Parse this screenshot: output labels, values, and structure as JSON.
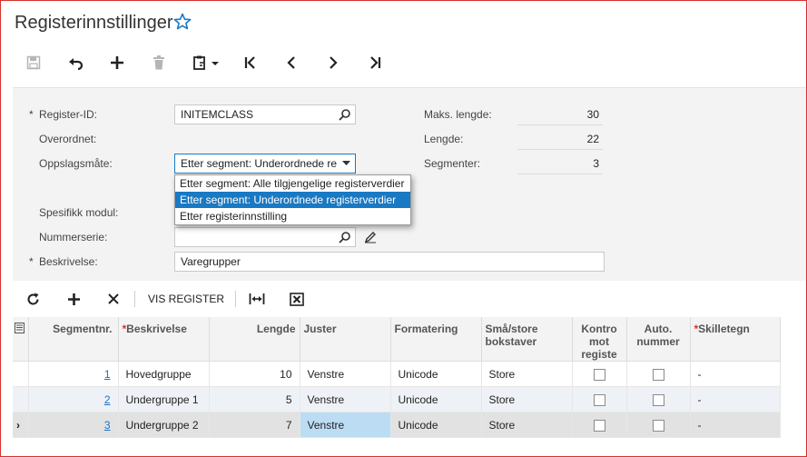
{
  "page": {
    "title": "Registerinnstillinger"
  },
  "toolbar": {
    "icons": [
      "save-icon",
      "undo-icon",
      "add-icon",
      "delete-icon",
      "paste-icon",
      "first-icon",
      "prev-icon",
      "next-icon",
      "last-icon"
    ]
  },
  "form": {
    "register_id": {
      "label": "Register-ID:",
      "value": "INITEMCLASS"
    },
    "overordnet": {
      "label": "Overordnet:"
    },
    "oppslagsmate": {
      "label": "Oppslagsmåte:",
      "value": "Etter segment: Underordnede re",
      "options": [
        "Etter segment: Alle tilgjengelige registerverdier",
        "Etter segment: Underordnede registerverdier",
        "Etter registerinnstilling"
      ],
      "selected_index": 1
    },
    "spesifikk_modul": {
      "label": "Spesifikk modul:"
    },
    "nummerserie": {
      "label": "Nummerserie:"
    },
    "beskrivelse": {
      "label": "Beskrivelse:",
      "value": "Varegrupper"
    },
    "maks_lengde": {
      "label": "Maks. lengde:",
      "value": "30"
    },
    "lengde": {
      "label": "Lengde:",
      "value": "22"
    },
    "segmenter": {
      "label": "Segmenter:",
      "value": "3"
    },
    "required_mark": "*"
  },
  "grid_toolbar": {
    "vis_register": "VIS REGISTER"
  },
  "grid": {
    "columns": [
      "Segmentnr.",
      "Beskrivelse",
      "Lengde",
      "Juster",
      "Formatering",
      "Små/store bokstaver",
      "Kontro mot registe",
      "Auto. nummer",
      "Skilletegn"
    ],
    "rows": [
      {
        "nr": "1",
        "beskrivelse": "Hovedgruppe",
        "lengde": "10",
        "juster": "Venstre",
        "formatering": "Unicode",
        "bokstaver": "Store",
        "skilletegn": "-"
      },
      {
        "nr": "2",
        "beskrivelse": "Undergruppe 1",
        "lengde": "5",
        "juster": "Venstre",
        "formatering": "Unicode",
        "bokstaver": "Store",
        "skilletegn": "-"
      },
      {
        "nr": "3",
        "beskrivelse": "Undergruppe 2",
        "lengde": "7",
        "juster": "Venstre",
        "formatering": "Unicode",
        "bokstaver": "Store",
        "skilletegn": "-"
      }
    ]
  },
  "colors": {
    "accent": "#1979c3",
    "link": "#1a73c6",
    "frame": "#d6302a"
  }
}
